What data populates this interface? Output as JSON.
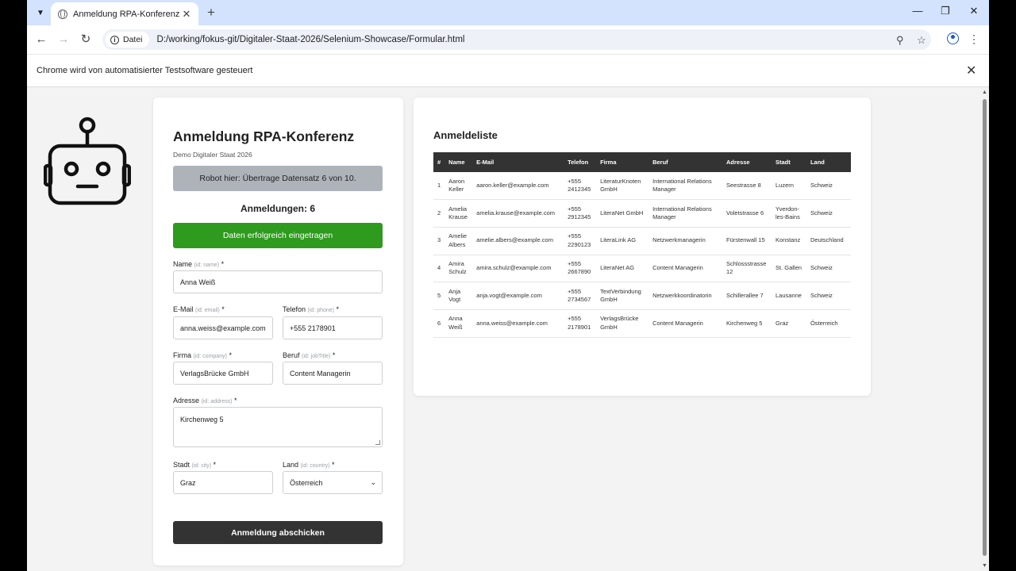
{
  "browser": {
    "tab_title": "Anmeldung RPA-Konferenz",
    "tab_close": "✕",
    "new_tab": "+",
    "url_chip": "Datei",
    "url": "D:/working/fokus-git/Digitaler-Staat-2026/Selenium-Showcase/Formular.html",
    "infobar_text": "Chrome wird von automatisierter Testsoftware gesteuert",
    "icons": [
      "search-icon",
      "back-icon",
      "forward-icon",
      "reload-icon",
      "info-icon",
      "zoom-icon",
      "star-icon",
      "profile-icon",
      "menu-icon",
      "minimize-icon",
      "restore-icon",
      "close-icon"
    ]
  },
  "form": {
    "title": "Anmeldung RPA-Konferenz",
    "subtitle": "Demo Digitaler Staat 2026",
    "robot_status": "Robot hier: Übertrage Datensatz 6 von 10.",
    "count_label": "Anmeldungen: 6",
    "success_message": "Daten erfolgreich eingetragen",
    "fields": {
      "name": {
        "label": "Name",
        "id": "(id: name)",
        "req": "*",
        "value": "Anna Weiß"
      },
      "email": {
        "label": "E-Mail",
        "id": "(id: email)",
        "req": "*",
        "value": "anna.weiss@example.com"
      },
      "phone": {
        "label": "Telefon",
        "id": "(id: phone)",
        "req": "*",
        "value": "+555 2178901"
      },
      "company": {
        "label": "Firma",
        "id": "(id: company)",
        "req": "*",
        "value": "VerlagsBrücke GmbH"
      },
      "job": {
        "label": "Beruf",
        "id": "(id: jobTitle)",
        "req": "*",
        "value": "Content Managerin"
      },
      "address": {
        "label": "Adresse",
        "id": "(id: address)",
        "req": "*",
        "value": "Kirchenweg 5"
      },
      "city": {
        "label": "Stadt",
        "id": "(id: city)",
        "req": "*",
        "value": "Graz"
      },
      "country": {
        "label": "Land",
        "id": "(id: country)",
        "req": "*",
        "value": "Österreich"
      }
    },
    "submit_label": "Anmeldung abschicken",
    "colors": {
      "success": "#2e9a1e",
      "status_bg": "#aeb3ba",
      "submit_bg": "#333333"
    }
  },
  "list": {
    "title": "Anmeldeliste",
    "headers": [
      "#",
      "Name",
      "E-Mail",
      "Telefon",
      "Firma",
      "Beruf",
      "Adresse",
      "Stadt",
      "Land"
    ],
    "rows": [
      [
        "1",
        "Aaron Keller",
        "aaron.keller@example.com",
        "+555 2412345",
        "LiteraturKnoten GmbH",
        "International Relations Manager",
        "Seestrasse 8",
        "Luzern",
        "Schweiz"
      ],
      [
        "2",
        "Amelia Krause",
        "amelia.krause@example.com",
        "+555 2912345",
        "LiteraNet GmbH",
        "International Relations Manager",
        "Voletstrasse 6",
        "Yverdon-les-Bains",
        "Schweiz"
      ],
      [
        "3",
        "Amelie Albers",
        "amelie.albers@example.com",
        "+555 2290123",
        "LiteraLink AG",
        "Netzwerkmanagerin",
        "Fürstenwall 15",
        "Konstanz",
        "Deutschland"
      ],
      [
        "4",
        "Amira Schulz",
        "amira.schulz@example.com",
        "+555 2667890",
        "LiteraNet AG",
        "Content Managerin",
        "Schlossstrasse 12",
        "St. Gallen",
        "Schweiz"
      ],
      [
        "5",
        "Anja Vogt",
        "anja.vogt@example.com",
        "+555 2734567",
        "TextVerbindung GmbH",
        "Netzwerkkoordinatorin",
        "Schillerallee 7",
        "Lausanne",
        "Schweiz"
      ],
      [
        "6",
        "Anna Weiß",
        "anna.weiss@example.com",
        "+555 2178901",
        "VerlagsBrücke GmbH",
        "Content Managerin",
        "Kirchenweg 5",
        "Graz",
        "Österreich"
      ]
    ]
  }
}
